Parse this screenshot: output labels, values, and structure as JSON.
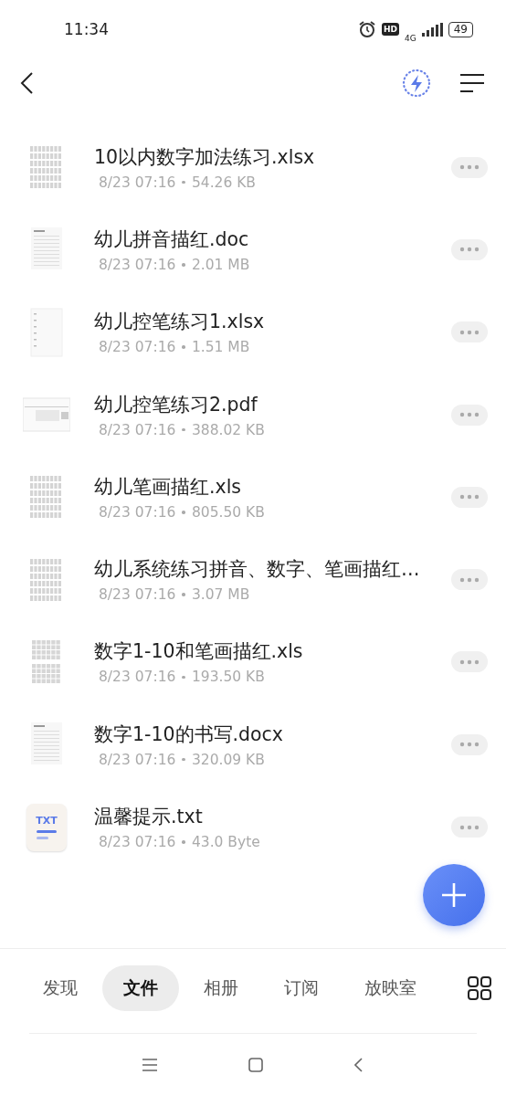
{
  "status_bar": {
    "time": "11:34",
    "hd": "HD",
    "network": "4G",
    "battery": "49"
  },
  "files": [
    {
      "name": "10以内数字加法练习.xlsx",
      "date": "8/23 07:16",
      "size": "54.26 KB",
      "kind": "sheet"
    },
    {
      "name": "幼儿拼音描红.doc",
      "date": "8/23 07:16",
      "size": "2.01 MB",
      "kind": "doc"
    },
    {
      "name": "幼儿控笔练习1.xlsx",
      "date": "8/23 07:16",
      "size": "1.51 MB",
      "kind": "sparse"
    },
    {
      "name": "幼儿控笔练习2.pdf",
      "date": "8/23 07:16",
      "size": "388.02 KB",
      "kind": "wide"
    },
    {
      "name": "幼儿笔画描红.xls",
      "date": "8/23 07:16",
      "size": "805.50 KB",
      "kind": "sheet"
    },
    {
      "name": "幼儿系统练习拼音、数字、笔画描红…",
      "date": "8/23 07:16",
      "size": "3.07 MB",
      "kind": "sheet"
    },
    {
      "name": "数字1-10和笔画描红.xls",
      "date": "8/23 07:16",
      "size": "193.50 KB",
      "kind": "split"
    },
    {
      "name": "数字1-10的书写.docx",
      "date": "8/23 07:16",
      "size": "320.09 KB",
      "kind": "doc"
    },
    {
      "name": "温馨提示.txt",
      "date": "8/23 07:16",
      "size": "43.0 Byte",
      "kind": "txt",
      "badge": "TXT"
    }
  ],
  "tabs": [
    {
      "label": "发现",
      "selected": false
    },
    {
      "label": "文件",
      "selected": true
    },
    {
      "label": "相册",
      "selected": false
    },
    {
      "label": "订阅",
      "selected": false
    },
    {
      "label": "放映室",
      "selected": false
    }
  ]
}
